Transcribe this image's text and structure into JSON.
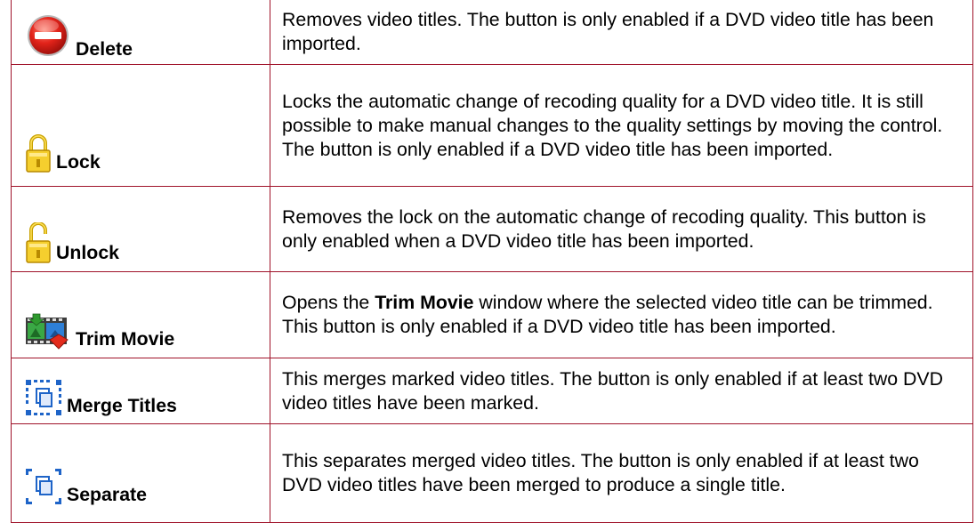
{
  "rows": [
    {
      "label": "Delete",
      "icon": "delete-icon",
      "description": "Removes video titles. The button is only enabled if a DVD video title has been imported."
    },
    {
      "label": "Lock",
      "icon": "lock-closed-icon",
      "description": "Locks the automatic change of recoding quality for a DVD video title. It is still possible to make manual changes to the quality settings by moving the control. The button is only enabled if a DVD video title has been imported."
    },
    {
      "label": "Unlock",
      "icon": "lock-open-icon",
      "description": "Removes the lock on the automatic change of recoding quality. This button is only enabled when a DVD video title has been imported."
    },
    {
      "label": "Trim Movie",
      "icon": "trim-movie-icon",
      "description_pre": "Opens the ",
      "description_bold": "Trim Movie",
      "description_post": " window where the selected video title can be trimmed. This button is only enabled if a DVD video title has been imported."
    },
    {
      "label": "Merge Titles",
      "icon": "merge-titles-icon",
      "description": "This merges marked video titles. The button is only enabled if at least two DVD video titles have been marked."
    },
    {
      "label": "Separate",
      "icon": "separate-icon",
      "description": "This separates merged video titles. The button is only enabled if at least two DVD video titles have been merged to produce a single title."
    }
  ]
}
